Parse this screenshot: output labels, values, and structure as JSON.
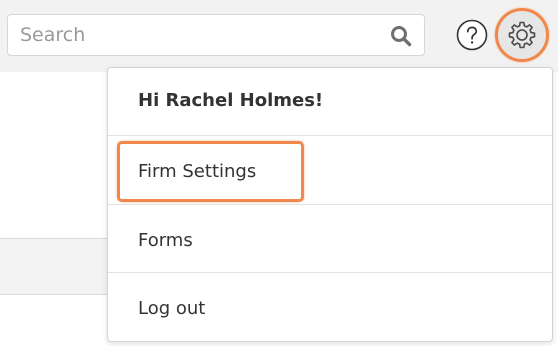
{
  "header": {
    "search": {
      "placeholder": "Search",
      "value": ""
    },
    "icons": {
      "search": "magnifier-icon",
      "help": "question-circle-icon",
      "settings": "gear-icon"
    }
  },
  "settings_menu": {
    "greeting": "Hi Rachel Holmes!",
    "items": [
      {
        "label": "Firm Settings",
        "highlighted": true
      },
      {
        "label": "Forms",
        "highlighted": false
      },
      {
        "label": "Log out",
        "highlighted": false
      }
    ]
  },
  "colors": {
    "highlight": "#f0884b",
    "topbar_bg": "#f2f2f2",
    "text": "#333333"
  }
}
